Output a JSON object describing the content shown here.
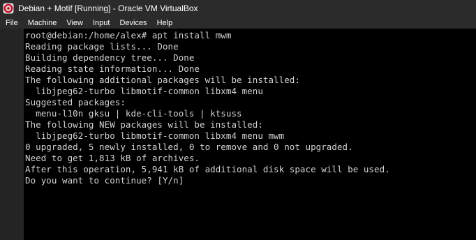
{
  "window": {
    "title": "Debian + Motif [Running] - Oracle VM VirtualBox",
    "icon": "virtualbox-icon"
  },
  "menubar": {
    "items": [
      {
        "label": "File"
      },
      {
        "label": "Machine"
      },
      {
        "label": "View"
      },
      {
        "label": "Input"
      },
      {
        "label": "Devices"
      },
      {
        "label": "Help"
      }
    ]
  },
  "terminal": {
    "lines": [
      "root@debian:/home/alex# apt install mwm",
      "Reading package lists... Done",
      "Building dependency tree... Done",
      "Reading state information... Done",
      "The following additional packages will be installed:",
      "  libjpeg62-turbo libmotif-common libxm4 menu",
      "Suggested packages:",
      "  menu-l10n gksu | kde-cli-tools | ktsuss",
      "The following NEW packages will be installed:",
      "  libjpeg62-turbo libmotif-common libxm4 menu mwm",
      "0 upgraded, 5 newly installed, 0 to remove and 0 not upgraded.",
      "Need to get 1,813 kB of archives.",
      "After this operation, 5,941 kB of additional disk space will be used.",
      "Do you want to continue? [Y/n]"
    ]
  }
}
